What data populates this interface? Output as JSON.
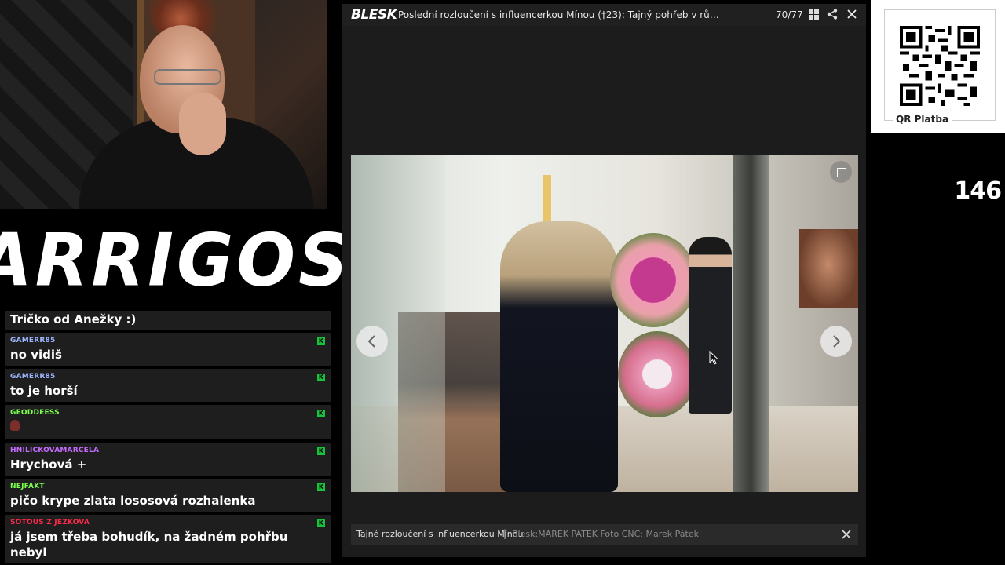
{
  "viewer": {
    "brand": "BLESK",
    "title": "Poslední rozloučení s influencerkou Mínou (†23): Tajný pohřeb v růžové ra...",
    "counter": "70/77",
    "caption": "Tajné rozloučení s influencerkou Mínou",
    "separator": "|",
    "credit": "Blesk:MAREK PATEK Foto CNC: Marek Pátek",
    "icons": [
      "grid-icon",
      "share-icon",
      "close-icon",
      "expand-icon",
      "chevron-left-icon",
      "chevron-right-icon"
    ]
  },
  "stream": {
    "logo": "ARRIGOS",
    "viewer_count": "146",
    "qr_label": "QR Platba"
  },
  "chat": {
    "first_text": "Tričko od Anežky :)",
    "badge": "K",
    "messages": [
      {
        "user": "GAMERR85",
        "text": "no vidiš",
        "color": "#9db7ff"
      },
      {
        "user": "GAMERR85",
        "text": "to je horší",
        "color": "#9db7ff"
      },
      {
        "user": "GEODDEESS",
        "text": "",
        "color": "#7cff4f"
      },
      {
        "user": "HNILICKOVAMARCELA",
        "text": "Hrychová +",
        "color": "#c56bff"
      },
      {
        "user": "NEJFAKT",
        "text": "pičo krype zlata lososová rozhalenka",
        "color": "#7cff4f"
      },
      {
        "user": "SOTOUS Z JEZKOVA",
        "text": "já jsem třeba bohudík, na žadném pohřbu nebyl",
        "color": "#ff2a4a"
      }
    ]
  }
}
